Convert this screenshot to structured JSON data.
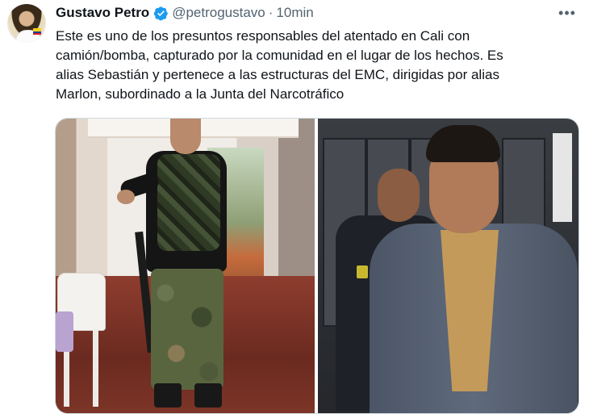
{
  "tweet": {
    "author_name": "Gustavo Petro",
    "handle": "@petrogustavo",
    "separator": "·",
    "timestamp": "10min",
    "more_label": "•••",
    "verified_icon": "verified-badge-icon",
    "text": "Este es uno de los presuntos responsables del atentado en Cali con\ncamión/bomba, capturado por la comunidad en el lugar de los hechos. Es\nalias Sebastián y pertenece a las estructuras del EMC, dirigidas por alias\nMarlon, subordinado a la Junta del Narcotráfico",
    "media_count": 2
  },
  "colors": {
    "text_primary": "#0f1419",
    "text_secondary": "#536471",
    "verified_blue": "#1d9bf0",
    "border": "#cfd9de"
  }
}
